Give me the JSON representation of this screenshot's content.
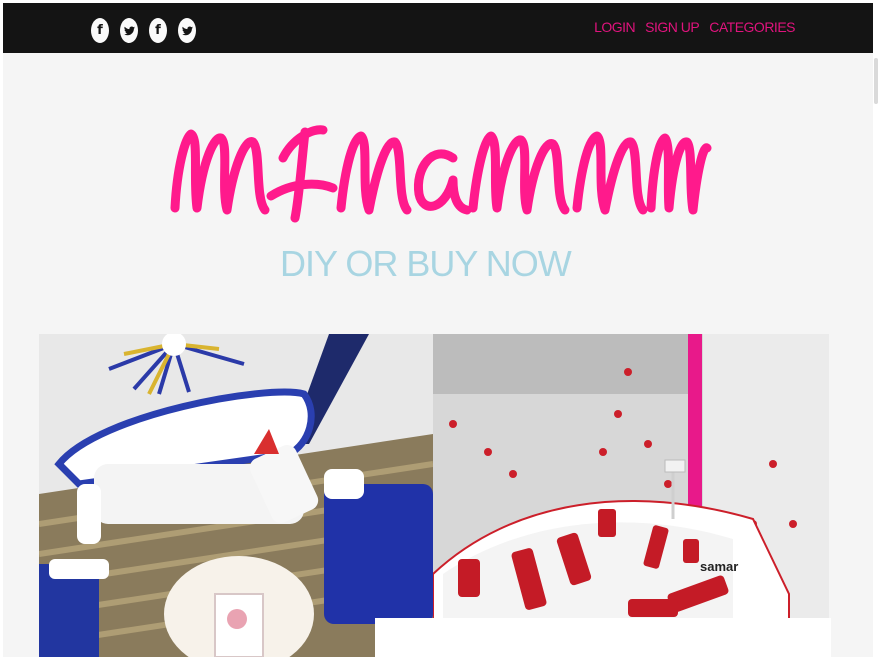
{
  "header": {
    "social_icons": [
      {
        "name": "facebook-icon",
        "glyph": "f"
      },
      {
        "name": "twitter-icon",
        "glyph": "t"
      },
      {
        "name": "facebook-icon",
        "glyph": "f"
      },
      {
        "name": "twitter-icon",
        "glyph": "t"
      }
    ],
    "nav": {
      "login": "LOGIN",
      "signup": "SIGN UP",
      "categories": "CATEGORIES"
    },
    "nav_color": "#e0137d"
  },
  "brand": {
    "logo_text": "minamnm",
    "tagline": "DIY OR BUY NOW",
    "logo_color": "#ff1a8c",
    "tagline_color": "#a8d5e2"
  },
  "hero": {
    "right_photo_caption": "samar"
  }
}
